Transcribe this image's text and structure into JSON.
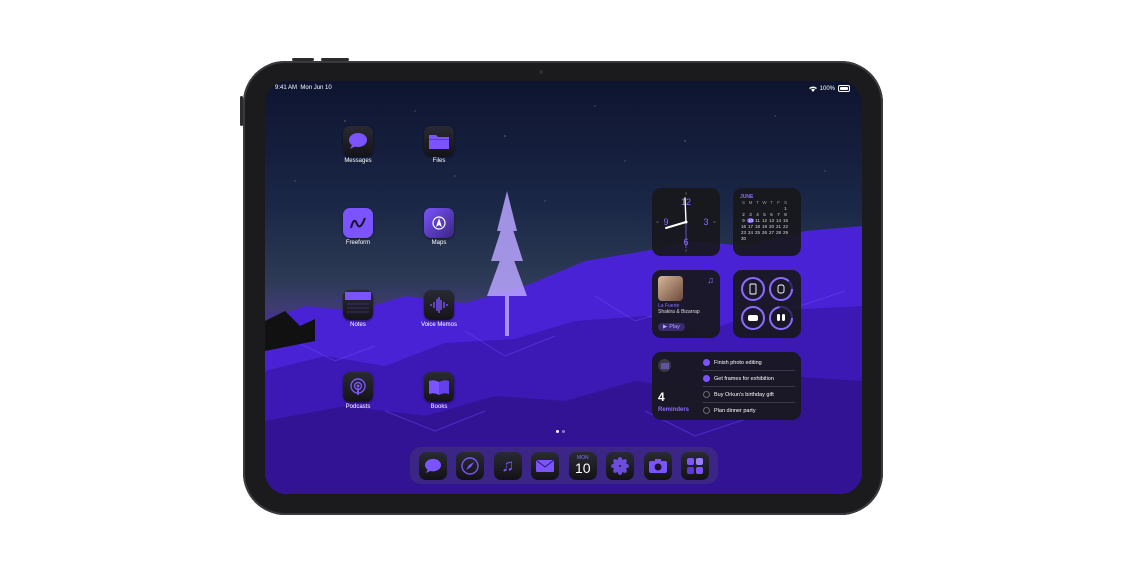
{
  "status_bar": {
    "time": "9:41 AM",
    "date": "Mon Jun 10",
    "battery": "100%"
  },
  "apps": [
    {
      "label": "Messages",
      "icon": "messages-icon"
    },
    {
      "label": "Files",
      "icon": "folder-icon"
    },
    {
      "label": "Freeform",
      "icon": "freeform-icon"
    },
    {
      "label": "Maps",
      "icon": "maps-icon"
    },
    {
      "label": "Notes",
      "icon": "notes-icon"
    },
    {
      "label": "Voice Memos",
      "icon": "waveform-icon"
    },
    {
      "label": "Podcasts",
      "icon": "podcasts-icon"
    },
    {
      "label": "Books",
      "icon": "book-icon"
    }
  ],
  "clock_widget": {
    "numerals": [
      "12",
      "3",
      "6",
      "9"
    ]
  },
  "calendar_widget": {
    "month": "JUNE",
    "weekdays": [
      "S",
      "M",
      "T",
      "W",
      "T",
      "F",
      "S"
    ],
    "rows": [
      [
        "",
        "",
        "",
        "",
        "",
        "",
        "1"
      ],
      [
        "2",
        "3",
        "4",
        "5",
        "6",
        "7",
        "8"
      ],
      [
        "9",
        "10",
        "11",
        "12",
        "13",
        "14",
        "15"
      ],
      [
        "16",
        "17",
        "18",
        "19",
        "20",
        "21",
        "22"
      ],
      [
        "23",
        "24",
        "25",
        "26",
        "27",
        "28",
        "29"
      ],
      [
        "30",
        "",
        "",
        "",
        "",
        "",
        ""
      ]
    ],
    "today": "10"
  },
  "music_widget": {
    "title": "La Fuerte",
    "artist": "Shakira & Bizarrap",
    "play_label": "Play"
  },
  "batteries_widget": {
    "devices": [
      "ipad-icon",
      "watch-icon",
      "case-icon",
      "airpods-icon"
    ]
  },
  "reminders_widget": {
    "count": "4",
    "label": "Reminders",
    "items": [
      {
        "text": "Finish photo editing",
        "done": true
      },
      {
        "text": "Get frames for exhibition",
        "done": true
      },
      {
        "text": "Buy Orkun's birthday gift",
        "done": false
      },
      {
        "text": "Plan dinner party",
        "done": false
      }
    ]
  },
  "dock": {
    "calendar_day": "MON",
    "calendar_date": "10",
    "items": [
      "messages-icon",
      "safari-icon",
      "music-icon",
      "mail-icon",
      "calendar-icon",
      "photos-icon",
      "camera-icon",
      "app-library-icon"
    ]
  },
  "colors": {
    "accent": "#7b54ff",
    "wallpaper": "#4a24c8"
  }
}
